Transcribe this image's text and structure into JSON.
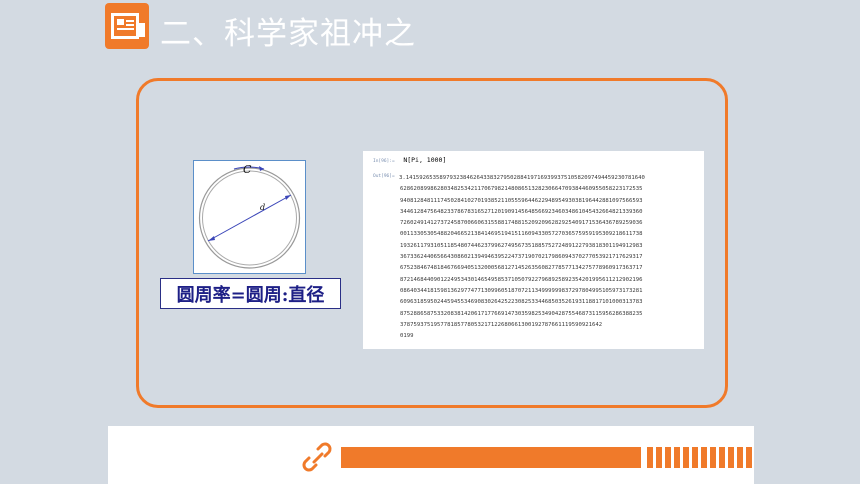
{
  "title": "二、科学家祖冲之",
  "figure": {
    "circumference_label": "C",
    "diameter_label": "d",
    "caption": "圆周率=圆周:直径"
  },
  "pi_output": {
    "input_label": "In[96]:=",
    "command": "N[Pi, 1000]",
    "output_label": "Out[96]=",
    "rows": [
      "3.14159265358979323846264338327950288419716939937510582097494459230781640",
      "628620899862803482534211706798214808651328230664709384460955058223172535",
      "940812848111745028410270193852110555964462294895493038196442881097566593",
      "344612847564823378678316527120190914564856692346034861045432664821339360",
      "726024914127372458700660631558817488152092096282925409171536436789259036",
      "001133053054882046652138414695194151160943305727036575959195309218611738",
      "193261179310511854807446237996274956735188575272489122793818301194912983",
      "367336244065664308602139494639522473719070217986094370277053921717629317",
      "675238467481846766940513200056812714526356082778577134275778960917363717",
      "872146844090122495343014654958537105079227968925892354201995611212902196",
      "086403441815981362977477130996051870721134999999837297804995105973173281",
      "609631859502445945534690830264252230825334468503526193118817101000313783",
      "875288658753320838142061717766914730359825349042875546873115956286388235",
      "378759375195778185778053217122680661300192787661119590921642",
      "0199"
    ]
  },
  "colors": {
    "background": "#d3dae2",
    "accent": "#f07a2a",
    "caption_text": "#1d1f86"
  },
  "icons": {
    "title": "presentation-icon",
    "footer": "link-icon"
  }
}
